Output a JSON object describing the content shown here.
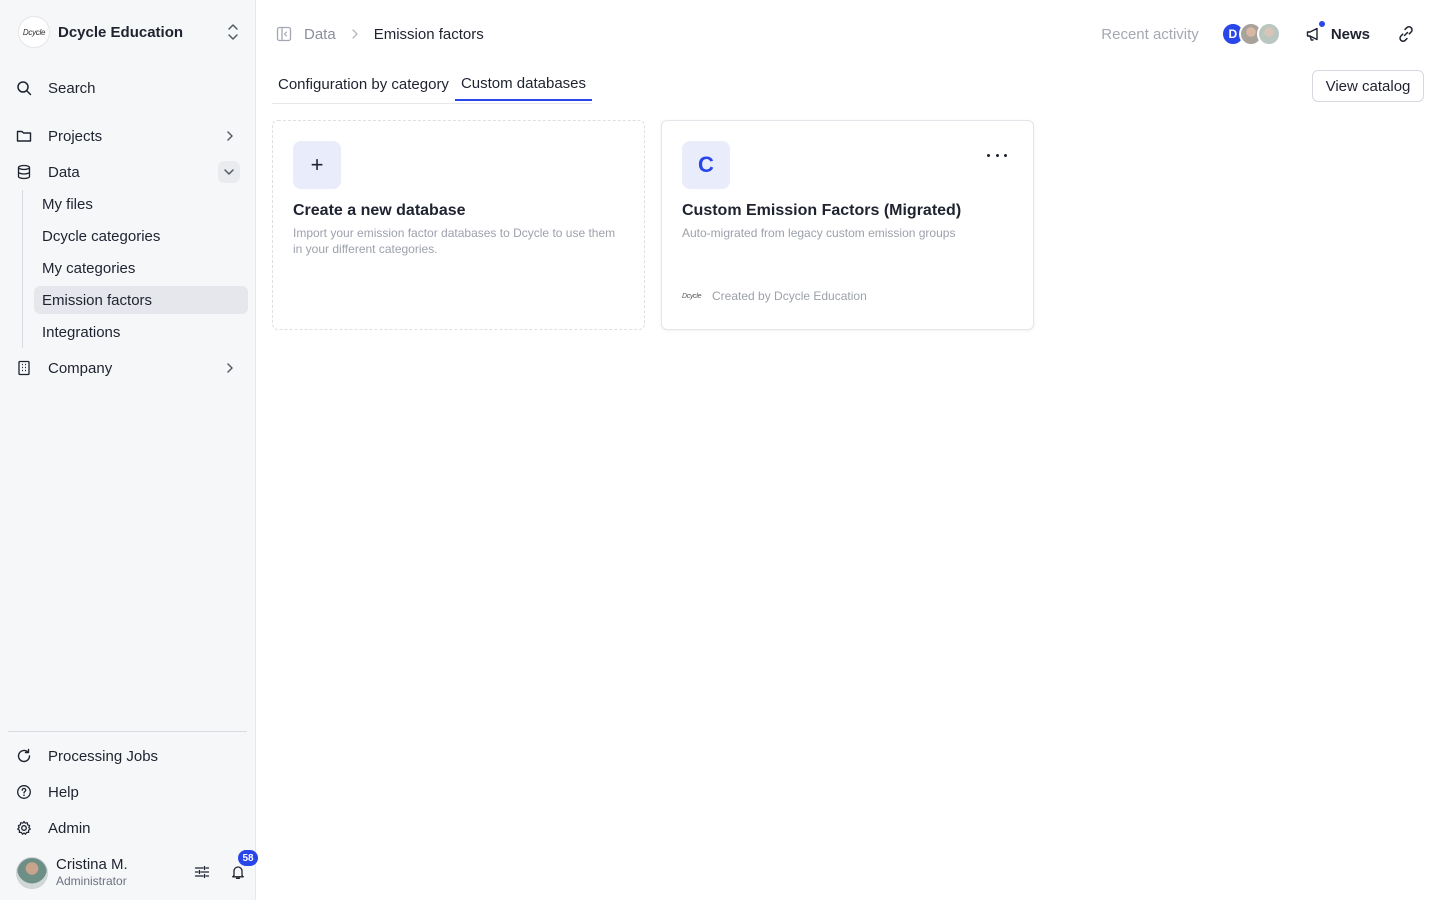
{
  "org": {
    "name": "Dcycle Education",
    "logo_text": "Dcycle"
  },
  "sidebar": {
    "search_label": "Search",
    "projects_label": "Projects",
    "data_label": "Data",
    "data_children": [
      "My files",
      "Dcycle categories",
      "My categories",
      "Emission factors",
      "Integrations"
    ],
    "active_child": "Emission factors",
    "company_label": "Company",
    "processing_jobs_label": "Processing Jobs",
    "help_label": "Help",
    "admin_label": "Admin"
  },
  "user": {
    "name": "Cristina M.",
    "role": "Administrator",
    "notification_count": "58"
  },
  "header": {
    "breadcrumb_parent": "Data",
    "breadcrumb_current": "Emission factors",
    "recent_activity": "Recent activity",
    "collaborator_initial": "D",
    "news_label": "News"
  },
  "tabs": [
    {
      "label": "Configuration by category",
      "active": false
    },
    {
      "label": "Custom databases",
      "active": true
    }
  ],
  "view_catalog_label": "View catalog",
  "cards": {
    "new": {
      "icon": "+",
      "title": "Create a new database",
      "description": "Import your emission factor databases to Dcycle to use them in your different categories."
    },
    "db": {
      "icon_letter": "C",
      "title": "Custom Emission Factors (Migrated)",
      "description": "Auto-migrated from legacy custom emission groups",
      "creator_logo_text": "Dcycle",
      "created_by": "Created by Dcycle Education"
    }
  },
  "colors": {
    "accent": "#2946e8",
    "sidebar_bg": "#f6f7f9",
    "active_item_bg": "#e5e7ec"
  },
  "icons": [
    "search-icon",
    "folder-icon",
    "database-icon",
    "building-icon",
    "refresh-icon",
    "help-circle-icon",
    "gear-icon",
    "sliders-icon",
    "bell-icon",
    "panel-toggle-icon",
    "chevron-right-icon",
    "chevron-down-icon",
    "megaphone-icon",
    "link-icon",
    "plus-icon",
    "ellipsis-icon",
    "chevrons-up-down-icon"
  ]
}
